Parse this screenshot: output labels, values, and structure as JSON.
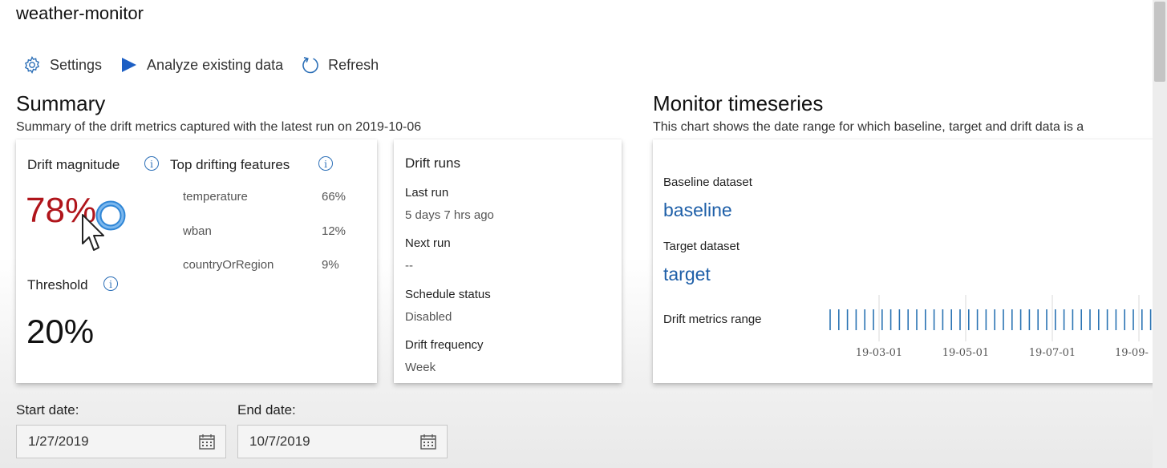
{
  "app_title": "weather-monitor",
  "toolbar": {
    "settings": "Settings",
    "analyze": "Analyze existing data",
    "refresh": "Refresh"
  },
  "summary": {
    "title": "Summary",
    "subtitle": "Summary of the drift metrics captured with the latest run on 2019-10-06",
    "drift_magnitude_label": "Drift magnitude",
    "drift_magnitude_value": "78%",
    "threshold_label": "Threshold",
    "threshold_value": "20%",
    "top_features_label": "Top drifting features",
    "features": [
      {
        "name": "temperature",
        "value": "66%"
      },
      {
        "name": "wban",
        "value": "12%"
      },
      {
        "name": "countryOrRegion",
        "value": "9%"
      }
    ]
  },
  "drift_runs": {
    "title": "Drift runs",
    "last_run_label": "Last run",
    "last_run_value": "5 days 7 hrs ago",
    "next_run_label": "Next run",
    "next_run_value": "--",
    "schedule_label": "Schedule status",
    "schedule_value": "Disabled",
    "frequency_label": "Drift frequency",
    "frequency_value": "Week"
  },
  "timeseries": {
    "title": "Monitor timeseries",
    "subtitle": "This chart shows the date range for which baseline, target and drift data is a",
    "baseline_label": "Baseline dataset",
    "baseline_value": "baseline",
    "target_label": "Target dataset",
    "target_value": "target",
    "drift_range_label": "Drift metrics range",
    "axis_ticks": [
      "19-03-01",
      "19-05-01",
      "19-07-01",
      "19-09-"
    ]
  },
  "dates": {
    "start_label": "Start date:",
    "start_value": "1/27/2019",
    "end_label": "End date:",
    "end_value": "10/7/2019"
  },
  "colors": {
    "accent": "#1e5fa8",
    "drift_red": "#b0151b",
    "tick_blue": "#2a73b3"
  }
}
